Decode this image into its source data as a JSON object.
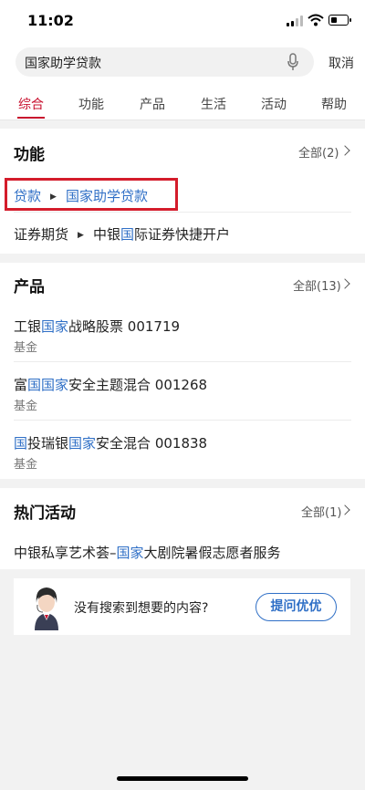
{
  "status": {
    "time": "11:02"
  },
  "search": {
    "query": "国家助学贷款",
    "cancel": "取消"
  },
  "tabs": [
    "综合",
    "功能",
    "产品",
    "生活",
    "活动",
    "帮助"
  ],
  "features": {
    "title": "功能",
    "more": "全部(2)",
    "items": [
      {
        "parent": "贷款",
        "child": "国家助学贷款"
      },
      {
        "parent": "证券期货",
        "child_pre": "中银",
        "child_hl": "国",
        "child_post": "际证券快捷开户"
      }
    ]
  },
  "products": {
    "title": "产品",
    "more": "全部(13)",
    "items": [
      {
        "pre": "工银",
        "hl": "国家",
        "post": "战略股票 001719",
        "sub": "基金"
      },
      {
        "pre": "富",
        "hl": "国国家",
        "post": "安全主题混合 001268",
        "sub": "基金"
      },
      {
        "pre": "",
        "hl": "国",
        "mid": "投瑞银",
        "hl2": "国家",
        "post": "安全混合 001838",
        "sub": "基金"
      }
    ]
  },
  "activities": {
    "title": "热门活动",
    "more": "全部(1)",
    "item": {
      "pre": "中银私享艺术荟–",
      "hl": "国家",
      "post": "大剧院暑假志愿者服务"
    }
  },
  "help": {
    "text": "没有搜索到想要的内容?",
    "button": "提问优优"
  },
  "colors": {
    "accent_red": "#c8102e",
    "link_blue": "#2f6fc6"
  }
}
